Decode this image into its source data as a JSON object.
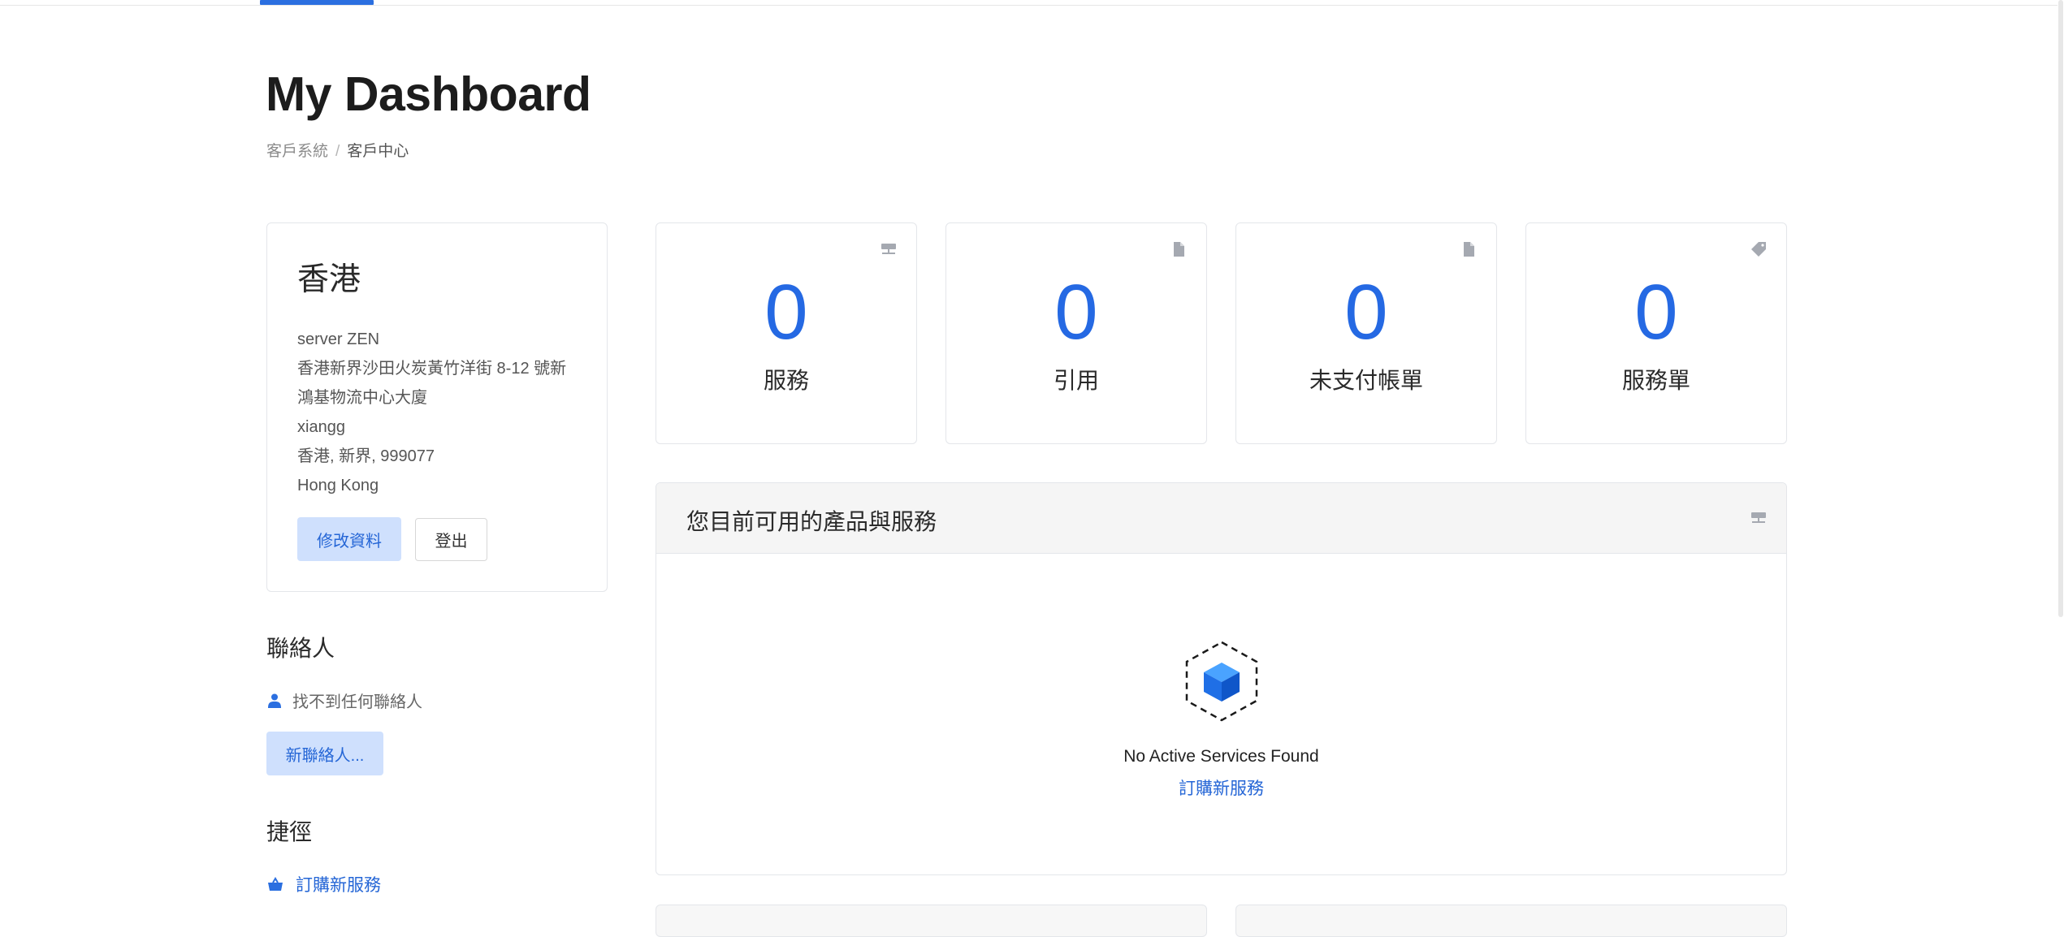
{
  "page": {
    "title": "My Dashboard",
    "breadcrumb": [
      "客戶系統",
      "客戶中心"
    ]
  },
  "account": {
    "region": "香港",
    "lines": [
      "server ZEN",
      "香港新界沙田火炭黃竹洋街 8-12 號新",
      "鴻基物流中心大廈",
      "xiangg",
      "香港, 新界, 999077",
      "Hong Kong"
    ],
    "edit_label": "修改資料",
    "logout_label": "登出"
  },
  "contacts": {
    "title": "聯絡人",
    "empty_text": "找不到任何聯絡人",
    "new_label": "新聯絡人..."
  },
  "shortcuts": {
    "title": "捷徑",
    "items": [
      {
        "label": "訂購新服務",
        "icon": "basket-icon"
      }
    ]
  },
  "stats": [
    {
      "value": "0",
      "label": "服務",
      "icon": "server-icon"
    },
    {
      "value": "0",
      "label": "引用",
      "icon": "document-icon"
    },
    {
      "value": "0",
      "label": "未支付帳單",
      "icon": "document-icon"
    },
    {
      "value": "0",
      "label": "服務單",
      "icon": "tag-icon"
    }
  ],
  "services_panel": {
    "title": "您目前可用的產品與服務",
    "icon": "server-icon",
    "empty_text": "No Active Services Found",
    "order_link": "訂購新服務"
  },
  "colors": {
    "accent": "#2569e3",
    "soft_button": "#cfe0fd",
    "panel_header": "#f5f5f5"
  }
}
